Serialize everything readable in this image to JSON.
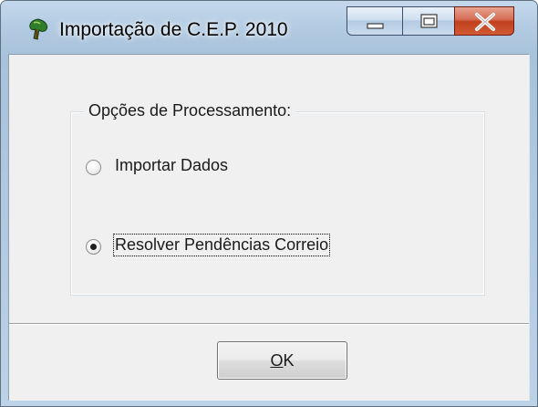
{
  "window": {
    "title": "Importação de C.E.P. 2010",
    "icon": "app-tree-icon",
    "caption_buttons": [
      "minimize-icon",
      "maximize-icon",
      "close-icon"
    ]
  },
  "group": {
    "legend": "Opções de Processamento:"
  },
  "options": [
    {
      "label": "Importar Dados",
      "selected": false
    },
    {
      "label": "Resolver Pendências Correio",
      "selected": true,
      "focused": true
    }
  ],
  "ok_button": {
    "mnemonic": "O",
    "rest": "K"
  },
  "colors": {
    "close_button": "#c84a2a",
    "client_background": "#f0f0f0",
    "frame": "#b2cbe2"
  }
}
